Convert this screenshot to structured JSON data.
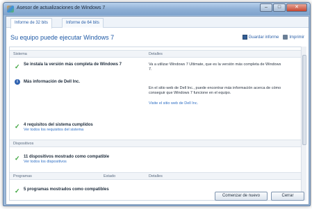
{
  "window": {
    "title": "Asesor de actualizaciones de Windows 7",
    "buttons": {
      "minimize": "–",
      "maximize": "□",
      "close": "✕"
    }
  },
  "tabs": [
    {
      "label": "Informe de 32 bits",
      "active": true
    },
    {
      "label": "Informe de 64 bits",
      "active": false
    }
  ],
  "header": {
    "title": "Su equipo puede ejecutar Windows 7",
    "save_label": "Guardar informe",
    "print_label": "Imprimir"
  },
  "sections": {
    "system": {
      "col1": "Sistema",
      "col2": "Detalles",
      "item1_title": "Se instala la versión más completa de Windows 7",
      "item1_detail": "Va a utilizar Windows 7 Ultimate, que es la versión más completa de Windows 7.",
      "item2_title": "Más información de Dell Inc.",
      "item2_detail": "En el sitio web de Dell Inc., puede encontrar más información acerca de cómo conseguir que Windows 7 funcione en el equipo.",
      "item2_link": "Visite el sitio web de Dell Inc.",
      "item3_title": "4 requisitos del sistema cumplidos",
      "item3_link": "Ver todos los requisitos del sistema"
    },
    "devices": {
      "col1": "Dispositivos",
      "item1_title": "11 dispositivos mostrado como compatible",
      "item1_link": "Ver todos los dispositivos"
    },
    "programs": {
      "col1": "Programas",
      "col2": "Estado",
      "col3": "Detalles",
      "item1_title": "5 programas mostrados como compatibles"
    }
  },
  "footer": {
    "restart_label": "Comenzar de nuevo",
    "close_label": "Cerrar"
  },
  "colors": {
    "accent": "#1f5aa6",
    "check": "#3aa33a",
    "link": "#2f6fc4"
  }
}
